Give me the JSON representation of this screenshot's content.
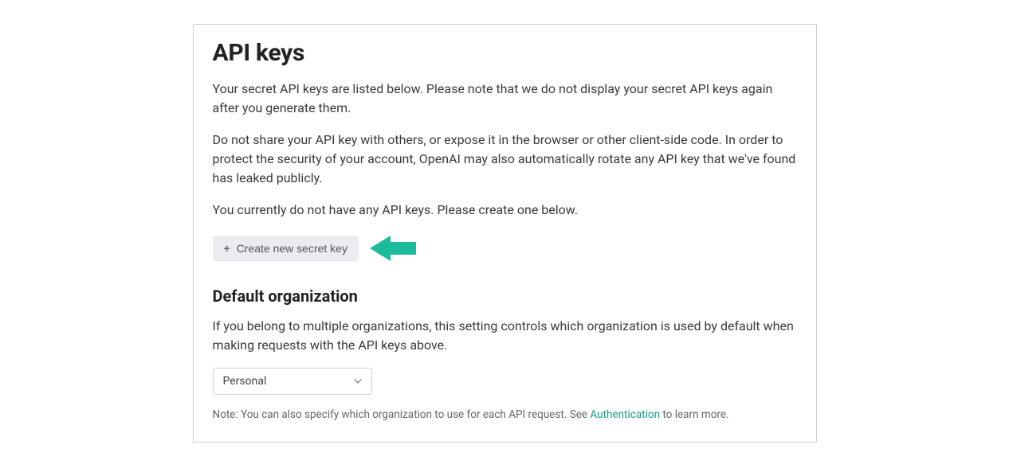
{
  "page": {
    "title": "API keys",
    "paragraph1": "Your secret API keys are listed below. Please note that we do not display your secret API keys again after you generate them.",
    "paragraph2": "Do not share your API key with others, or expose it in the browser or other client-side code. In order to protect the security of your account, OpenAI may also automatically rotate any API key that we've found has leaked publicly.",
    "empty_message": "You currently do not have any API keys. Please create one below.",
    "create_button_label": "Create new secret key"
  },
  "default_org": {
    "heading": "Default organization",
    "description": "If you belong to multiple organizations, this setting controls which organization is used by default when making requests with the API keys above.",
    "selected": "Personal",
    "note_prefix": "Note: You can also specify which organization to use for each API request. See ",
    "note_link_text": "Authentication",
    "note_suffix": " to learn more."
  },
  "colors": {
    "arrow": "#1abc9c",
    "link": "#16a085"
  }
}
